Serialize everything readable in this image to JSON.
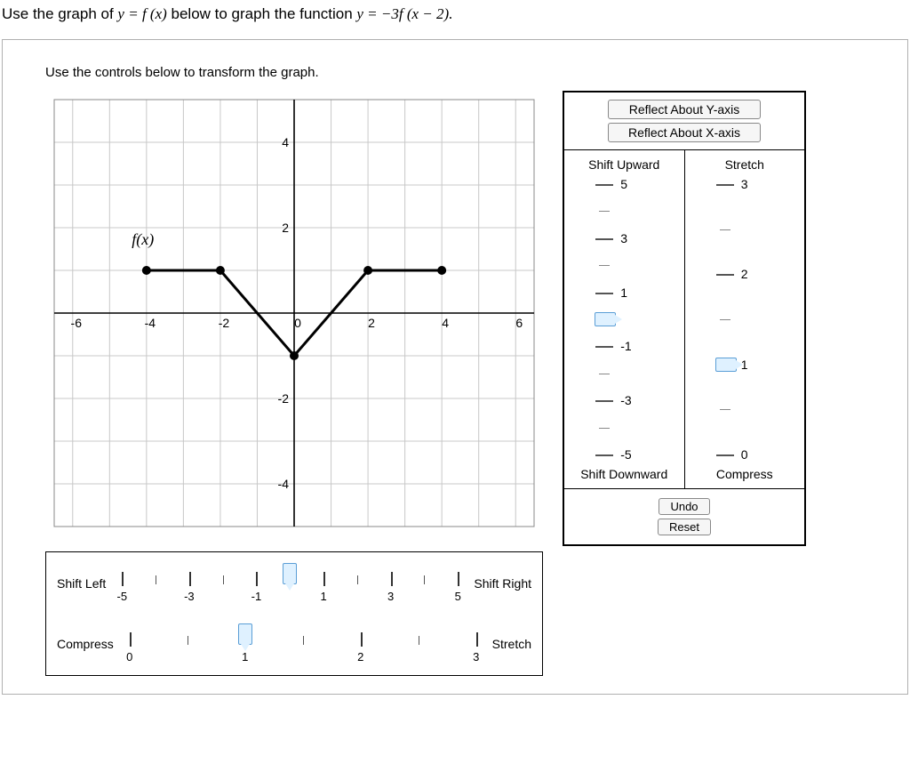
{
  "question_parts": {
    "p1": "Use the graph of ",
    "p2_math": "y = f (x)",
    "p3": " below to graph the function ",
    "p4_math": "y = −3f (x − 2).",
    "p5": ""
  },
  "inner_title": "Use the controls below to transform the graph.",
  "chart_data": {
    "type": "line",
    "title": "",
    "xlabel": "",
    "ylabel": "",
    "xlim": [
      -6.5,
      6.5
    ],
    "ylim": [
      -5,
      5
    ],
    "x_ticks": [
      -6,
      -4,
      -2,
      0,
      2,
      4,
      6
    ],
    "y_ticks": [
      -4,
      -2,
      0,
      2,
      4
    ],
    "function_label": "f(x)",
    "series": [
      {
        "name": "f(x)",
        "points": [
          [
            -4,
            1
          ],
          [
            -2,
            1
          ],
          [
            0,
            -1
          ],
          [
            2,
            1
          ],
          [
            4,
            1
          ]
        ]
      }
    ]
  },
  "right_controls": {
    "reflect_y": "Reflect About Y-axis",
    "reflect_x": "Reflect About X-axis",
    "shift_up": "Shift Upward",
    "shift_down": "Shift Downward",
    "stretch": "Stretch",
    "compress": "Compress",
    "undo": "Undo",
    "reset": "Reset",
    "shift_slider": {
      "min": -5,
      "max": 5,
      "value": 0,
      "major_ticks": [
        5,
        3,
        1,
        -1,
        -3,
        -5
      ],
      "labels": [
        "5",
        "3",
        "1",
        "-1",
        "-3",
        "-5"
      ]
    },
    "stretch_slider": {
      "min": 0,
      "max": 3,
      "value": 1,
      "major_ticks": [
        3,
        2,
        1,
        0
      ],
      "labels": [
        "3",
        "2",
        "1",
        "0"
      ]
    }
  },
  "h_controls": {
    "shift": {
      "left_label": "Shift Left",
      "right_label": "Shift Right",
      "min": -5,
      "max": 5,
      "value": 0,
      "major_ticks": [
        -5,
        -3,
        -1,
        1,
        3,
        5
      ],
      "labels": [
        "-5",
        "-3",
        "-1",
        "1",
        "3",
        "5"
      ]
    },
    "scale": {
      "left_label": "Compress",
      "right_label": "Stretch",
      "min": 0,
      "max": 3,
      "value": 1,
      "major_ticks": [
        0,
        1,
        2,
        3
      ],
      "labels": [
        "0",
        "1",
        "2",
        "3"
      ]
    }
  }
}
